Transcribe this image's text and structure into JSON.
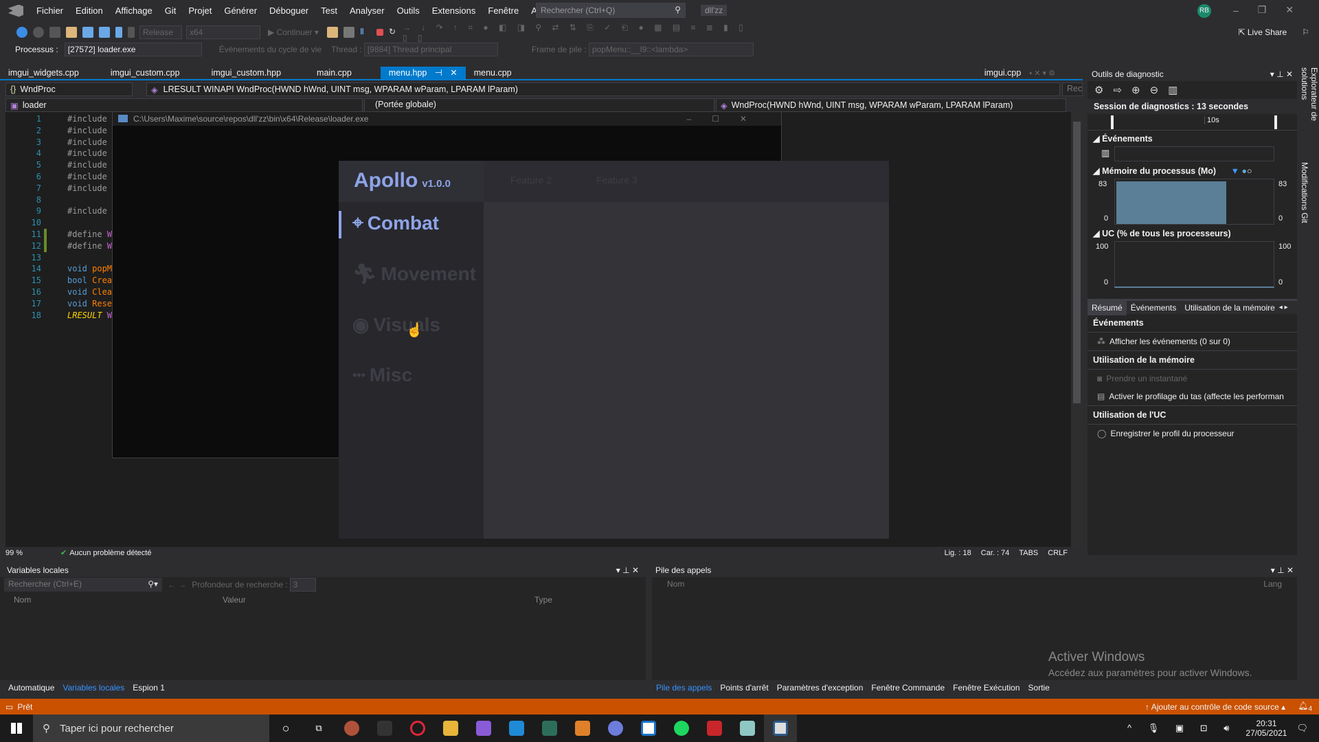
{
  "menubar": {
    "items": [
      "Fichier",
      "Edition",
      "Affichage",
      "Git",
      "Projet",
      "Générer",
      "Déboguer",
      "Test",
      "Analyser",
      "Outils",
      "Extensions",
      "Fenêtre",
      "Aide"
    ],
    "search_placeholder": "Rechercher (Ctrl+Q)",
    "solution": "dll'zz",
    "avatar": "RB"
  },
  "toolbar": {
    "config": "Release",
    "platform": "x64",
    "continue": "Continuer",
    "live_share": "Live Share"
  },
  "debugbar": {
    "process_label": "Processus :",
    "process": "[27572] loader.exe",
    "lifecycle": "Événements du cycle de vie",
    "thread_label": "Thread :",
    "thread": "[9884] Thread principal",
    "frame_label": "Frame de pile :",
    "frame": "popMenu::__l9::<lambda>"
  },
  "tabs": [
    "imgui_widgets.cpp",
    "imgui_custom.cpp",
    "imgui_custom.hpp",
    "main.cpp",
    "menu.hpp",
    "menu.cpp"
  ],
  "active_tab": "menu.hpp",
  "right_tab": "imgui.cpp",
  "nav": {
    "scope": "WndProc",
    "signature": "LRESULT WINAPI WndProc(HWND hWnd, UINT msg, WPARAM wParam, LPARAM lParam)",
    "project": "loader",
    "global": "(Portée globale)",
    "member": "WndProc(HWND hWnd, UINT msg, WPARAM wParam, LPARAM lParam)",
    "search_short": "Reche"
  },
  "code": [
    {
      "n": "1",
      "t": "#include"
    },
    {
      "n": "2",
      "t": "#include"
    },
    {
      "n": "3",
      "t": "#include"
    },
    {
      "n": "4",
      "t": "#include"
    },
    {
      "n": "5",
      "t": "#include"
    },
    {
      "n": "6",
      "t": "#include"
    },
    {
      "n": "7",
      "t": "#include"
    },
    {
      "n": "8",
      "t": ""
    },
    {
      "n": "9",
      "t": "#include"
    },
    {
      "n": "10",
      "t": ""
    },
    {
      "n": "11",
      "a": "#define ",
      "b": "W"
    },
    {
      "n": "12",
      "a": "#define ",
      "b": "W"
    },
    {
      "n": "13",
      "t": ""
    },
    {
      "n": "14",
      "a": "void ",
      "b": "popM"
    },
    {
      "n": "15",
      "a": "bool ",
      "b": "Crea"
    },
    {
      "n": "16",
      "a": "void ",
      "b": "Clea"
    },
    {
      "n": "17",
      "a": "void ",
      "b": "Rese"
    },
    {
      "n": "18",
      "a": "LRESULT ",
      "b": "W"
    }
  ],
  "console": {
    "title": "C:\\Users\\Maxime\\source\\repos\\dll'zz\\bin\\x64\\Release\\loader.exe"
  },
  "apollo": {
    "title": "Apollo",
    "version": "v1.0.0",
    "tabs": [
      "Feature 2",
      "Feature 3"
    ],
    "items": [
      "Combat",
      "Movement",
      "Visuals",
      "Misc"
    ],
    "active": "Combat",
    "accent": "#8ea4e8"
  },
  "editor_status": {
    "zoom": "99 %",
    "problems": "Aucun problème détecté",
    "line": "Lig. : 18",
    "col": "Car. : 74",
    "tabs": "TABS",
    "eol": "CRLF"
  },
  "diag": {
    "title": "Outils de diagnostic",
    "session": "Session de diagnostics : 13 secondes",
    "tick": "10s",
    "events": "Événements",
    "memory": "Mémoire du processus (Mo)",
    "mem_max": "83",
    "mem_min": "0",
    "mem_value_mb": 83,
    "cpu": "UC (% de tous les processeurs)",
    "cpu_max": "100",
    "cpu_min": "0",
    "tabs": [
      "Résumé",
      "Événements",
      "Utilisation de la mémoire"
    ],
    "sec_events": "Événements",
    "show_events": "Afficher les événements (0 sur 0)",
    "sec_mem": "Utilisation de la mémoire",
    "snapshot": "Prendre un instantané",
    "heap": "Activer le profilage du tas (affecte les performan",
    "sec_cpu": "Utilisation de l'UC",
    "cpu_profile": "Enregistrer le profil du processeur"
  },
  "side_tabs": [
    "Explorateur de solutions",
    "Modifications Git"
  ],
  "locals": {
    "title": "Variables locales",
    "search": "Rechercher (Ctrl+E)",
    "depth_label": "Profondeur de recherche :",
    "depth": "3",
    "cols": [
      "Nom",
      "Valeur",
      "Type"
    ],
    "tabs": [
      "Automatique",
      "Variables locales",
      "Espion 1"
    ]
  },
  "callstack": {
    "title": "Pile des appels",
    "cols": [
      "Nom",
      "Lang"
    ],
    "tabs": [
      "Pile des appels",
      "Points d'arrêt",
      "Paramètres d'exception",
      "Fenêtre Commande",
      "Fenêtre Exécution",
      "Sortie"
    ]
  },
  "watermark": {
    "line1": "Activer Windows",
    "line2": "Accédez aux paramètres pour activer Windows."
  },
  "statusbar": {
    "ready": "Prêt",
    "source_control": "Ajouter au contrôle de code source",
    "notif": "4"
  },
  "taskbar": {
    "search": "Taper ici pour rechercher",
    "time": "20:31",
    "date": "27/05/2021"
  }
}
